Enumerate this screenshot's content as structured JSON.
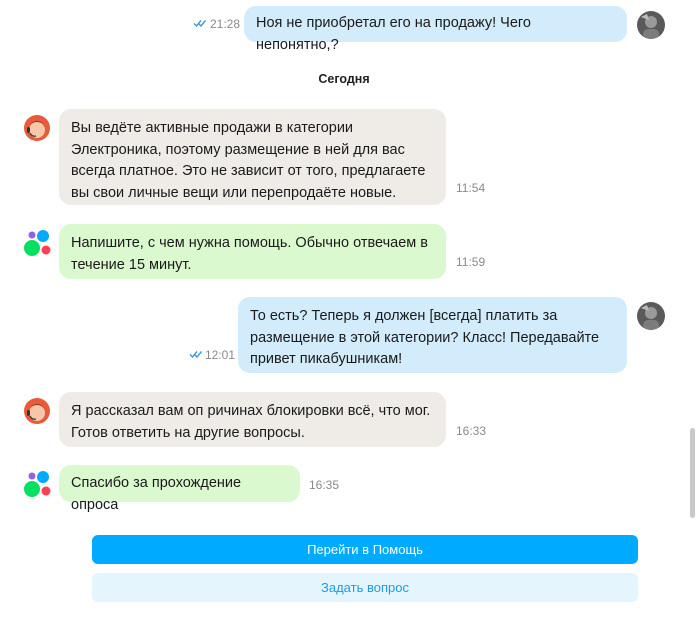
{
  "chat": {
    "day_separator": "Сегодня",
    "messages": [
      {
        "sender": "user",
        "text": "Ноя не приобретал его на продажу! Чего непонятно,?",
        "time": "21:28",
        "read": true
      },
      {
        "sender": "support",
        "text": "Вы ведёте активные продажи в категории\nЭлектроника, поэтому размещение в ней для вас\nвсегда платное. Это не зависит от того, предлагаете\nвы свои личные вещи или перепродаёте новые.",
        "time": "11:54"
      },
      {
        "sender": "bot",
        "text": "Напишите, с чем нужна помощь. Обычно отвечаем в\nтечение 15 минут.",
        "time": "11:59"
      },
      {
        "sender": "user",
        "text": "То есть? Теперь я должен [всегда] платить за\nразмещение в этой категории?   Класс! Передавайте\nпривет пикабушникам!",
        "time": "12:01",
        "read": true
      },
      {
        "sender": "support",
        "text": "Я рассказал вам оп ричинах блокировки всё, что мог.\nГотов ответить на другие вопросы.",
        "time": "16:33"
      },
      {
        "sender": "bot",
        "text": "Спасибо за прохождение опроса",
        "time": "16:35"
      }
    ]
  },
  "footer": {
    "primary_button": "Перейти в Помощь",
    "secondary_button": "Задать вопрос"
  },
  "colors": {
    "primary": "#00aaff",
    "user_bubble": "#d2ecfc",
    "support_bubble": "#efece8",
    "bot_bubble": "#dbf9cf"
  }
}
